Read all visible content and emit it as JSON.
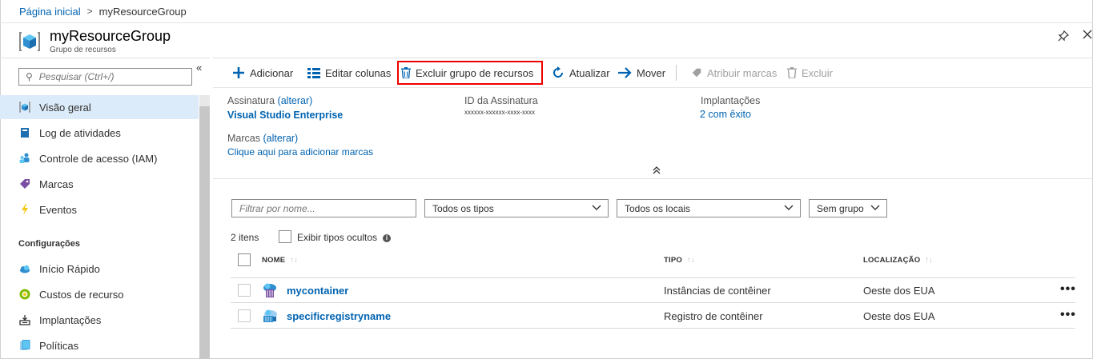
{
  "breadcrumb": {
    "home": "Página inicial",
    "separator": ">",
    "current": "myResourceGroup"
  },
  "header": {
    "title": "myResourceGroup",
    "subtitle": "Grupo de recursos",
    "icons": [
      "resource-group-icon",
      "pin-icon",
      "close-icon"
    ]
  },
  "sidebar": {
    "search_placeholder": "Pesquisar (Ctrl+/)",
    "collapse": "«",
    "items": [
      {
        "label": "Visão geral",
        "icon": "overview-icon",
        "active": true
      },
      {
        "label": "Log de atividades",
        "icon": "activity-log-icon"
      },
      {
        "label": "Controle de acesso (IAM)",
        "icon": "iam-icon"
      },
      {
        "label": "Marcas",
        "icon": "tag-icon"
      },
      {
        "label": "Eventos",
        "icon": "lightning-icon"
      }
    ],
    "section_title": "Configurações",
    "settings_items": [
      {
        "label": "Início Rápido",
        "icon": "cloud-icon"
      },
      {
        "label": "Custos de recurso",
        "icon": "cost-icon"
      },
      {
        "label": "Implantações",
        "icon": "deployments-icon"
      },
      {
        "label": "Políticas",
        "icon": "policies-icon"
      }
    ]
  },
  "toolbar": {
    "add": "Adicionar",
    "edit_columns": "Editar colunas",
    "delete_group": "Excluir grupo de recursos",
    "refresh": "Atualizar",
    "move": "Mover",
    "assign_tags": "Atribuir marcas",
    "delete": "Excluir"
  },
  "essentials": {
    "subscription_label": "Assinatura",
    "change": "(alterar)",
    "subscription_value": "Visual Studio Enterprise",
    "subscription_id_label": "ID da Assinatura",
    "subscription_id_value": "xxxxxx-xxxxxx-xxxx-xxxx",
    "deployments_label": "Implantações",
    "deployments_value": "2 com êxito",
    "tags_label": "Marcas",
    "tags_change": "(alterar)",
    "tags_value": "Clique aqui para adicionar marcas"
  },
  "filters": {
    "name_placeholder": "Filtrar por nome...",
    "type": "Todos os tipos",
    "location": "Todos os locais",
    "grouping": "Sem grupo"
  },
  "list": {
    "count": "2 itens",
    "show_hidden": "Exibir tipos ocultos",
    "columns": [
      "NOME",
      "TIPO",
      "LOCALIZAÇÃO"
    ],
    "rows": [
      {
        "name": "mycontainer",
        "type": "Instâncias de contêiner",
        "location": "Oeste dos EUA",
        "icon": "container-instance-icon"
      },
      {
        "name": "specificregistryname",
        "type": "Registro de contêiner",
        "location": "Oeste dos EUA",
        "icon": "container-registry-icon"
      }
    ],
    "more": "•••"
  },
  "colors": {
    "accent": "#0063b1",
    "active_nav": "#dcebf9",
    "highlight": "#e00000"
  }
}
